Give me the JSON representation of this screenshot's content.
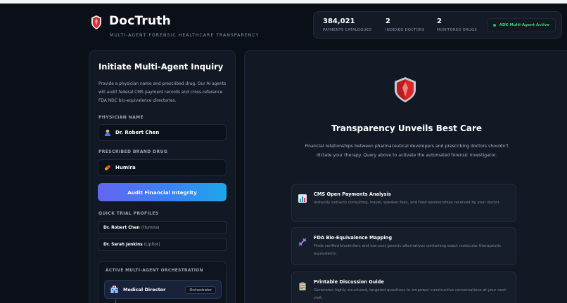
{
  "header": {
    "app_name": "DocTruth",
    "tagline": "MULTI-AGENT FORENSIC HEALTHCARE TRANSPARENCY",
    "stats": [
      {
        "value": "384,021",
        "label": "PAYMENTS CATALOGUED"
      },
      {
        "value": "2",
        "label": "INDEXED DOCTORS"
      },
      {
        "value": "2",
        "label": "MONITORED DRUGS"
      }
    ],
    "status_badge": "ADK Multi-Agent Active"
  },
  "inquiry": {
    "title": "Initiate Multi-Agent Inquiry",
    "description": "Provide a physician name and prescribed drug. Our AI agents will audit federal CMS payment records and cross-reference FDA NDC bio-equivalence directories.",
    "physician_label": "PHYSICIAN NAME",
    "physician_value": "Dr. Robert Chen",
    "drug_label": "PRESCRIBED BRAND DRUG",
    "drug_value": "Humira",
    "audit_button": "Audit Financial Integrity",
    "quick_profiles_label": "QUICK TRIAL PROFILES",
    "quick_profiles": [
      {
        "name": "Dr. Robert Chen",
        "drug": "(Humira)"
      },
      {
        "name": "Dr. Sarah Jenkins",
        "drug": "(Lipitor)"
      }
    ],
    "orchestration_label": "ACTIVE MULTI-AGENT ORCHESTRATION",
    "agent": {
      "name": "Medical Director",
      "role": "Orchestrator"
    }
  },
  "hero": {
    "title": "Transparency Unveils Best Care",
    "description": "Financial relationships between pharmaceutical developers and prescribing doctors shouldn't dictate your therapy. Query above to activate the automated forensic investigator."
  },
  "features": [
    {
      "icon": "bar-chart-icon",
      "title": "CMS Open Payments Analysis",
      "description": "Instantly extracts consulting, travel, speaker fees, and food sponsorships received by your doctor."
    },
    {
      "icon": "dna-icon",
      "title": "FDA Bio-Equivalence Mapping",
      "description": "Finds verified biosimilars and low-cost generic alternatives containing exact molecular therapeutic equivalents."
    },
    {
      "icon": "clipboard-icon",
      "title": "Printable Discussion Guide",
      "description": "Generates highly structured, targeted questions to empower constructive conversations at your next visit."
    }
  ],
  "colors": {
    "background": "#0b1018",
    "panel": "#121925",
    "accent_gradient_start": "#6366f1",
    "accent_gradient_end": "#1ea7e8",
    "status_green": "#22c55e",
    "shield_red": "#dc2626"
  }
}
